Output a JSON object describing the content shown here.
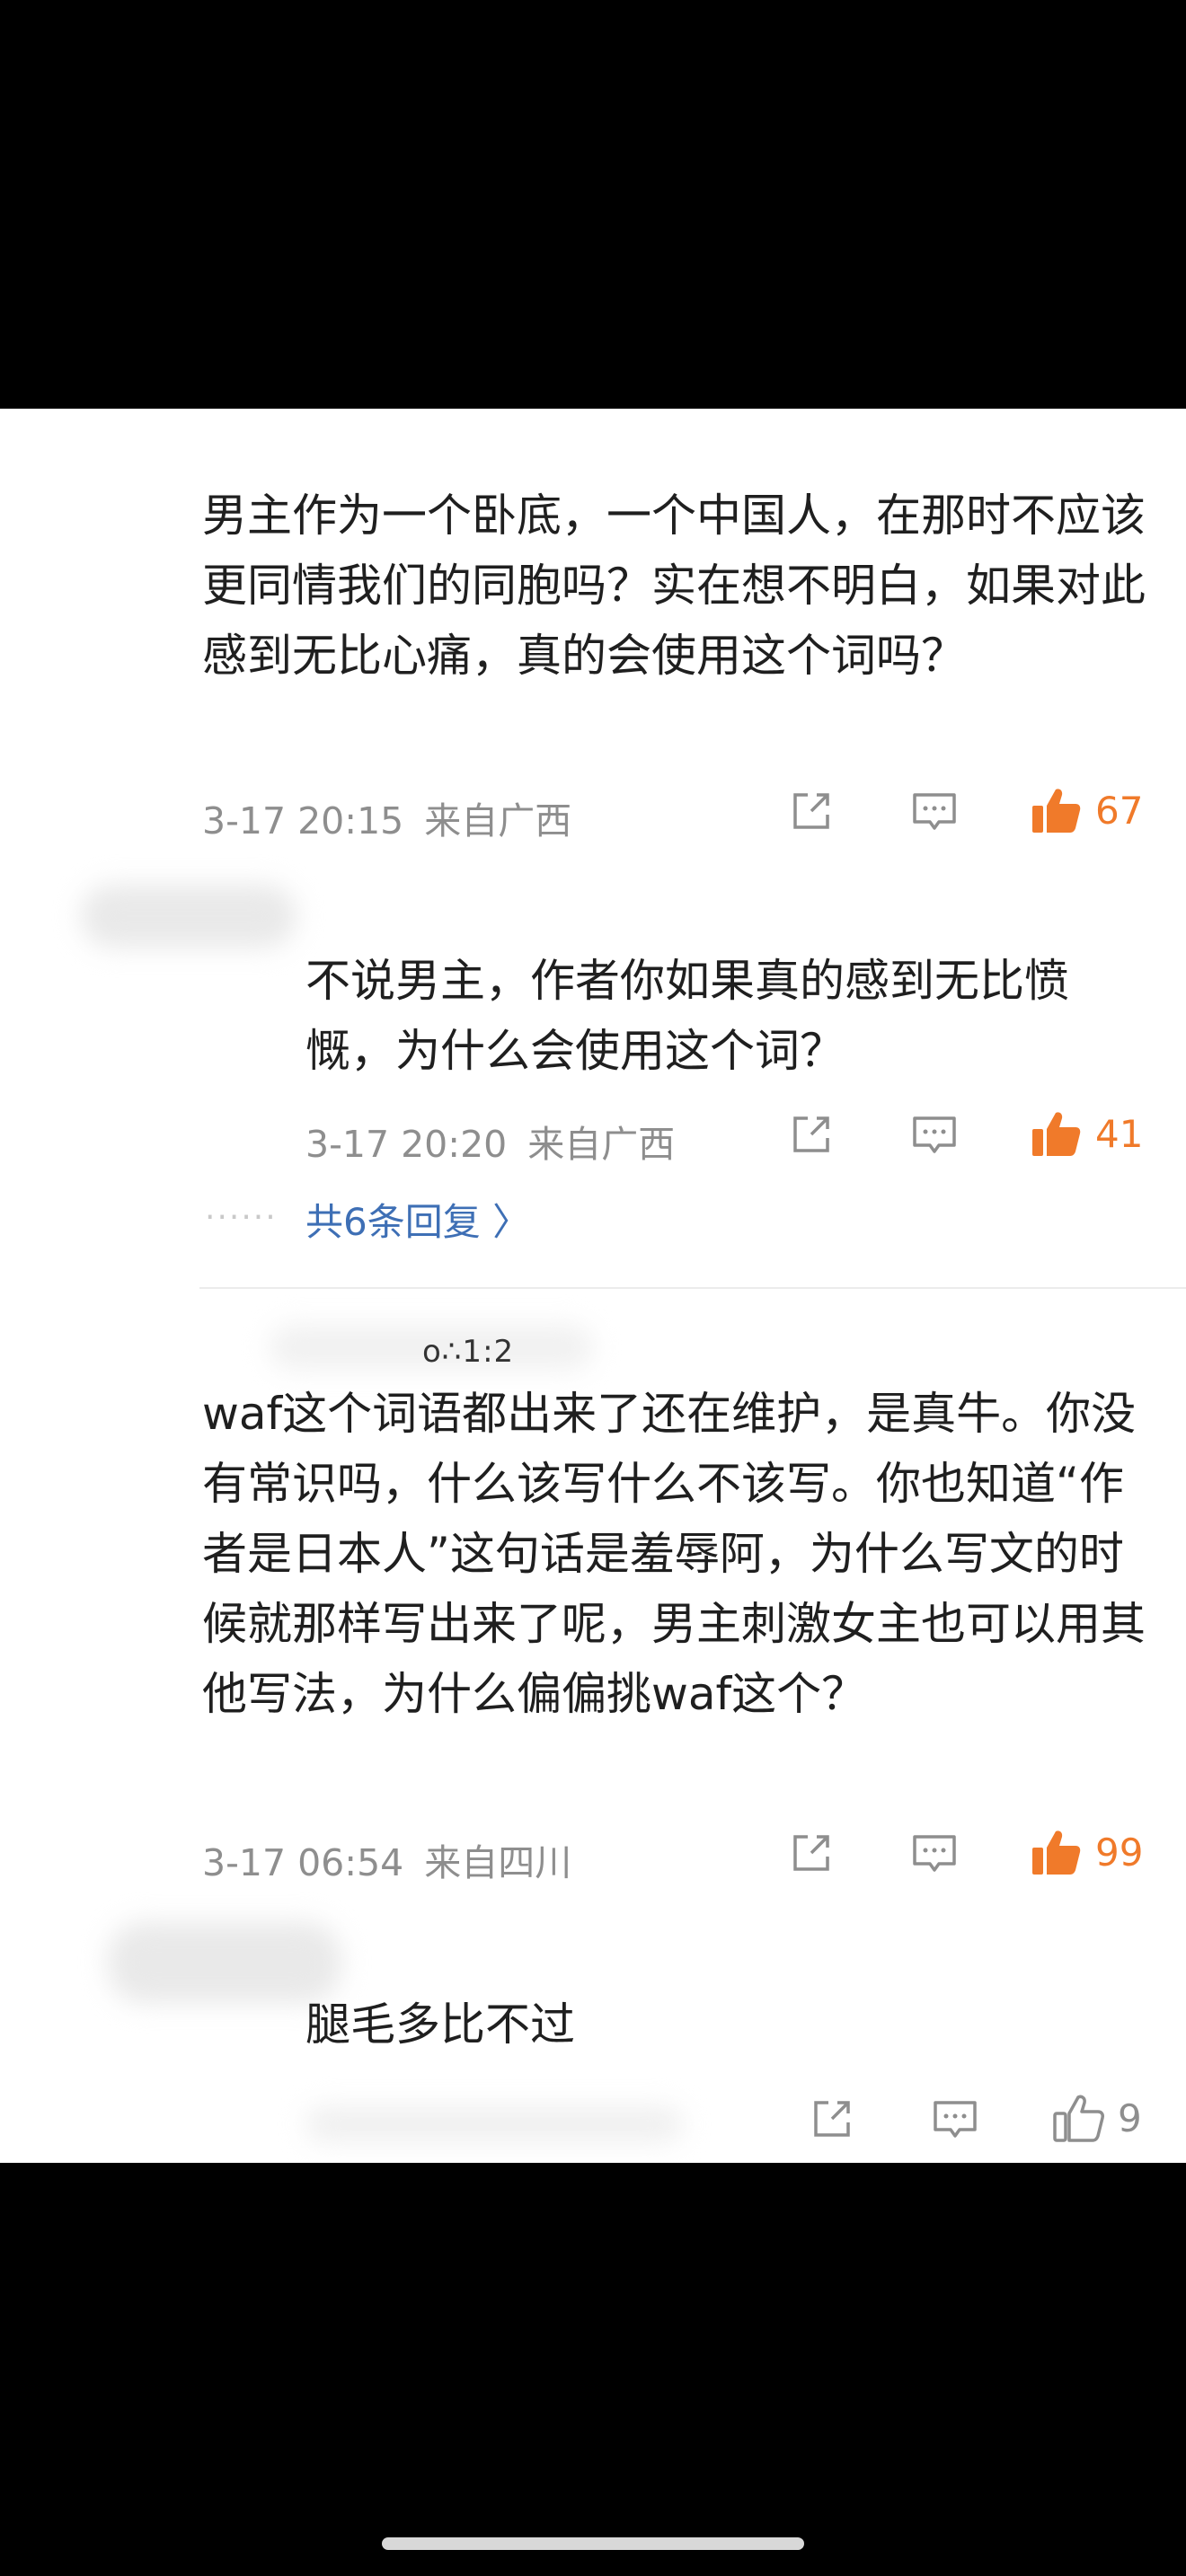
{
  "comments": [
    {
      "text": "男主作为一个卧底，一个中国人，在那时不应该更同情我们的同胞吗？实在想不明白，如果对此感到无比心痛，真的会使用这个词吗？",
      "time": "3-17 20:15",
      "location": "来自广西",
      "likes": "67",
      "reply": {
        "text": "不说男主，作者你如果真的感到无比愤慨，为什么会使用这个词？",
        "time": "3-17 20:20",
        "location": "来自广西",
        "likes": "41"
      },
      "more_replies": "共6条回复 〉",
      "dots": "······"
    },
    {
      "username_fragment": "o∴1:2",
      "text": "waf这个词语都出来了还在维护，是真牛。你没有常识吗，什么该写什么不该写。你也知道“作者是日本人”这句话是羞辱阿，为什么写文的时候就那样写出来了呢，男主刺激女主也可以用其他写法，为什么偏偏挑waf这个？",
      "time": "3-17 06:54",
      "location": "来自四川",
      "likes": "99",
      "reply": {
        "text": "腿毛多比不过",
        "likes": "9"
      }
    }
  ],
  "colors": {
    "like_active": "#f07a2a",
    "meta_gray": "#8e8e8e",
    "link_blue": "#3e6fb5"
  },
  "icons": [
    "share-icon",
    "comment-icon",
    "like-icon"
  ]
}
